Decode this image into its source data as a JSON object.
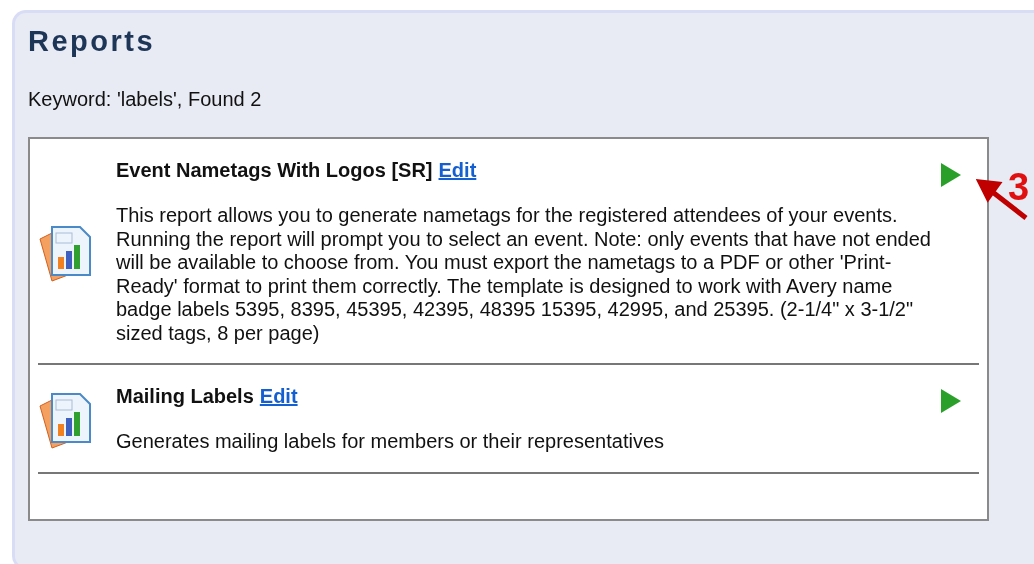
{
  "panel": {
    "title": "Reports",
    "summary": "Keyword: 'labels', Found 2"
  },
  "reports": [
    {
      "title": "Event Nametags With Logos [SR]",
      "edit_link": "Edit",
      "description": "This report allows you to generate nametags for the registered attendees of your events. Running the report will prompt you to select an event. Note: only events that have not ended will be available to choose from. You must export the nametags to a PDF or other 'Print-Ready' format to print them correctly. The template is designed to work with Avery name badge labels 5395, 8395, 45395, 42395, 48395 15395, 42995, and 25395. (2-1/4\" x 3-1/2\" sized tags, 8 per page)"
    },
    {
      "title": "Mailing Labels",
      "edit_link": "Edit",
      "description": "Generates mailing labels for members or their representatives"
    }
  ],
  "annotation": {
    "label": "3"
  }
}
